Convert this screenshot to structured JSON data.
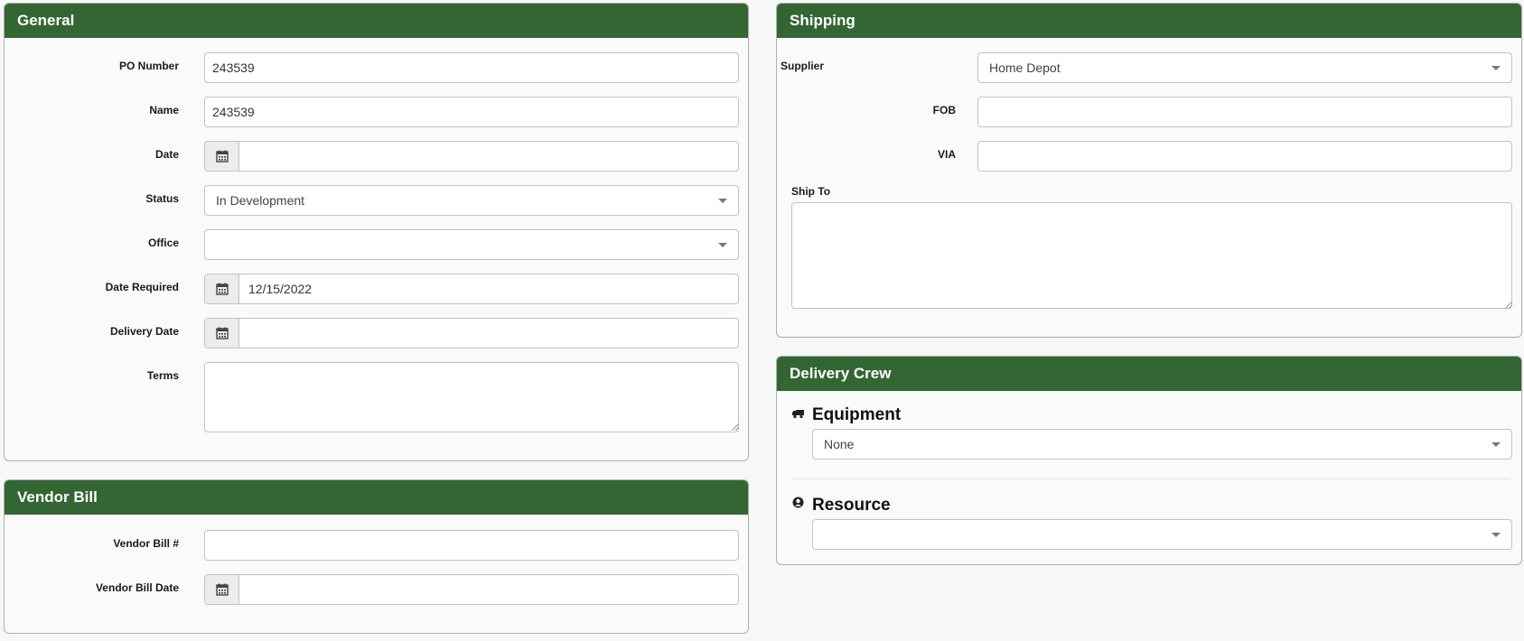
{
  "general": {
    "title": "General",
    "po_number": {
      "label": "PO Number",
      "value": "243539"
    },
    "name": {
      "label": "Name",
      "value": "243539"
    },
    "date": {
      "label": "Date",
      "value": ""
    },
    "status": {
      "label": "Status",
      "value": "In Development"
    },
    "office": {
      "label": "Office",
      "value": ""
    },
    "date_required": {
      "label": "Date Required",
      "value": "12/15/2022"
    },
    "delivery_date": {
      "label": "Delivery Date",
      "value": ""
    },
    "terms": {
      "label": "Terms",
      "value": ""
    }
  },
  "vendor_bill": {
    "title": "Vendor Bill",
    "number": {
      "label": "Vendor Bill #",
      "value": ""
    },
    "date": {
      "label": "Vendor Bill Date",
      "value": ""
    }
  },
  "shipping": {
    "title": "Shipping",
    "supplier": {
      "label": "Supplier",
      "value": "Home Depot"
    },
    "fob": {
      "label": "FOB",
      "value": ""
    },
    "via": {
      "label": "VIA",
      "value": ""
    },
    "ship_to": {
      "label": "Ship To",
      "value": ""
    }
  },
  "delivery_crew": {
    "title": "Delivery Crew",
    "equipment": {
      "label": "Equipment",
      "value": "None",
      "icon": "truck-icon"
    },
    "resource": {
      "label": "Resource",
      "value": "",
      "icon": "user-circle-icon"
    }
  },
  "colors": {
    "header": "#336633",
    "page_bg": "#f7f7f7",
    "panel_bg": "#fafafa"
  }
}
